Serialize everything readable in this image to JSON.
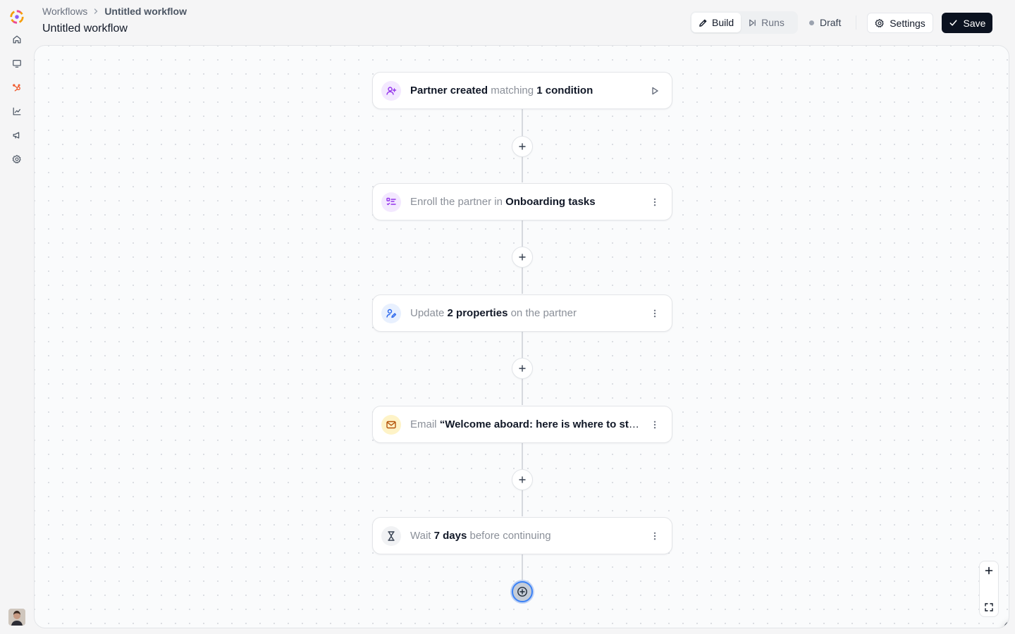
{
  "header": {
    "breadcrumb": {
      "root": "Workflows",
      "current": "Untitled workflow"
    },
    "title": "Untitled workflow",
    "modes": [
      {
        "label": "Build",
        "icon": "pencil-icon",
        "active": true
      },
      {
        "label": "Runs",
        "icon": "play-skip-icon",
        "active": false
      }
    ],
    "status": "Draft",
    "settings_label": "Settings",
    "save_label": "Save"
  },
  "sidebar": {
    "items": [
      {
        "name": "home",
        "icon": "home-icon"
      },
      {
        "name": "programs",
        "icon": "monitor-icon"
      },
      {
        "name": "integrations",
        "icon": "hubspot-icon",
        "active": true
      },
      {
        "name": "analytics",
        "icon": "chart-icon"
      },
      {
        "name": "campaigns",
        "icon": "megaphone-icon"
      },
      {
        "name": "settings",
        "icon": "gear-icon"
      }
    ]
  },
  "workflow": {
    "trigger": {
      "icon": "user-plus-icon",
      "parts": {
        "a": "Partner created",
        "b": " matching ",
        "c": "1 condition"
      }
    },
    "steps": [
      {
        "icon": "checklist-icon",
        "parts": {
          "a": "Enroll the partner in ",
          "b": "Onboarding tasks"
        }
      },
      {
        "icon": "user-edit-icon",
        "parts": {
          "a": "Update ",
          "b": "2 properties",
          "c": " on the partner"
        }
      },
      {
        "icon": "mail-icon",
        "parts": {
          "a": "Email ",
          "b": "“Welcome aboard: here is where to start”"
        }
      },
      {
        "icon": "hourglass-icon",
        "parts": {
          "a": "Wait ",
          "b": "7 days",
          "c": " before continuing"
        }
      }
    ]
  },
  "colors": {
    "accent_dark": "#0b1220",
    "trigger_icon_bg": "#f3e8ff",
    "trigger_icon": "#9333ea",
    "update_icon_bg": "#e8f0fe",
    "update_icon": "#2563eb",
    "email_icon_bg": "#fef3c7",
    "email_icon": "#b45309"
  }
}
